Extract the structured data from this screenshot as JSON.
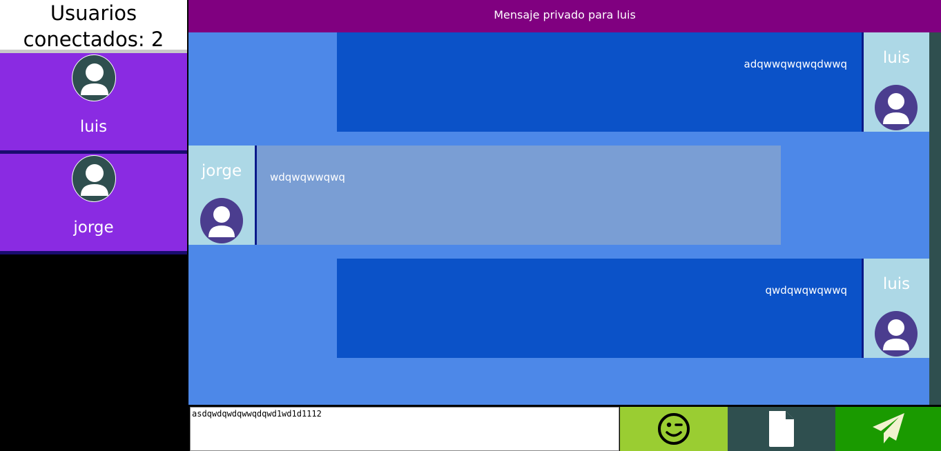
{
  "sidebar": {
    "header": "Usuarios conectados: 2",
    "users": [
      {
        "name": "luis",
        "icon": "user-avatar-icon"
      },
      {
        "name": "jorge",
        "icon": "user-avatar-icon"
      }
    ]
  },
  "topbar": {
    "title": "Mensaje privado para luis"
  },
  "messages": [
    {
      "author": "luis",
      "text": "adqwwqwqwqdwwq",
      "side": "right"
    },
    {
      "author": "jorge",
      "text": "wdqwqwwqwq",
      "side": "left"
    },
    {
      "author": "luis",
      "text": "qwdqwqwqwwq",
      "side": "right"
    }
  ],
  "composer": {
    "value": "asdqwdqwdqwwqdqwd1wd1d1112",
    "emoji_icon": "emoji-wink-icon",
    "file_icon": "file-icon",
    "send_icon": "send-paper-plane-icon"
  },
  "colors": {
    "sidebar_card": "#8a2be2",
    "topbar": "#800080",
    "chat_bg": "#4d88e8",
    "own_bubble": "#0b52c8",
    "other_bubble": "#7a9ed4",
    "author_bg": "#add8e6",
    "emoji_btn": "#9acd32",
    "file_btn": "#2f4f4f",
    "send_btn": "#1a9a00"
  }
}
